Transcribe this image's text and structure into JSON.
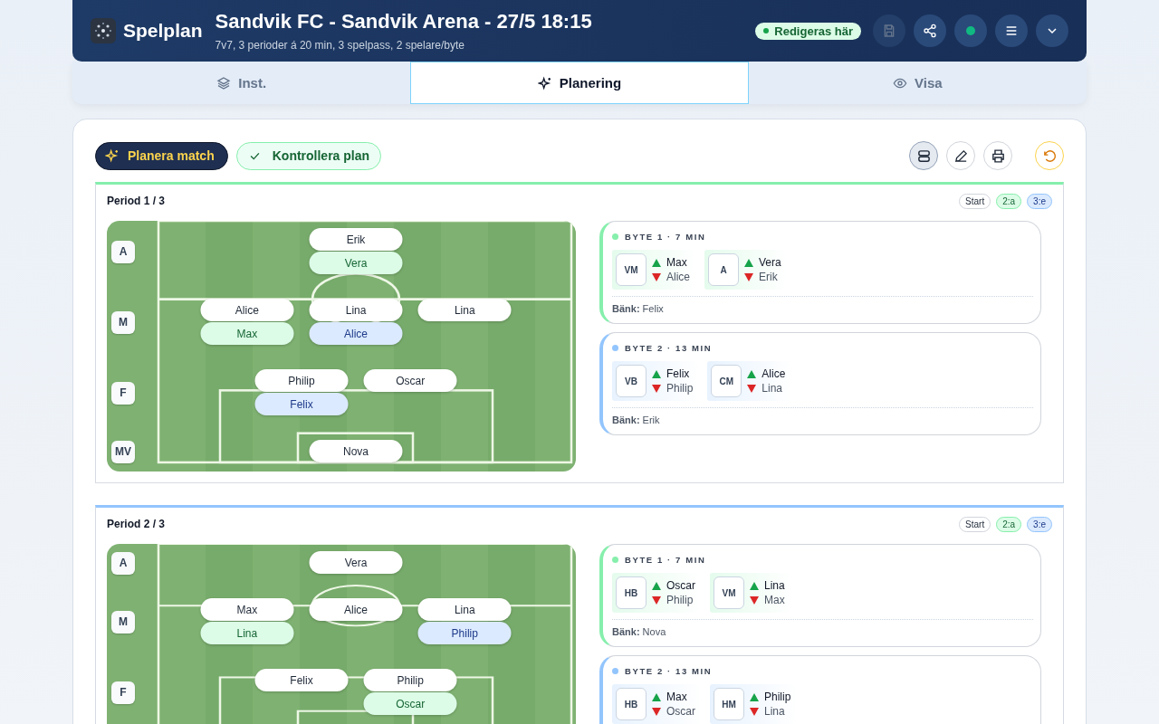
{
  "header": {
    "app_name": "Spelplan",
    "title": "Sandvik FC - Sandvik Arena - 27/5 18:15",
    "subtitle": "7v7, 3 perioder á 20 min, 3 spelpass, 2 spelare/byte",
    "badge": "Redigeras här",
    "buttons": [
      {
        "kind": "save",
        "disabled": true
      },
      {
        "kind": "share",
        "disabled": false
      },
      {
        "kind": "status",
        "disabled": false
      },
      {
        "kind": "menu",
        "disabled": false
      },
      {
        "kind": "chevron",
        "disabled": false
      }
    ]
  },
  "tabs": [
    {
      "label": "Inst.",
      "kind": "layers",
      "selected": false
    },
    {
      "label": "Planering",
      "kind": "sparkle",
      "selected": true
    },
    {
      "label": "Visa",
      "kind": "eye",
      "selected": false
    }
  ],
  "toolbar": {
    "primary": "Planera match",
    "secondary": "Kontrollera plan",
    "tools": [
      {
        "kind": "rows",
        "selected": true
      },
      {
        "kind": "pencil",
        "selected": false
      },
      {
        "kind": "printer",
        "selected": false
      },
      {
        "kind": "undo",
        "selected": false
      }
    ]
  },
  "periods": [
    {
      "title": "Period 1 / 3",
      "color": "#86efac",
      "legend": [
        {
          "label": "Start",
          "kind": "start"
        },
        {
          "label": "2:a",
          "kind": "second"
        },
        {
          "label": "3:e",
          "kind": "third"
        }
      ],
      "rows": [
        {
          "label": "A",
          "slots": [
            {
              "kind": "center",
              "players": [
                {
                  "name": "Erik",
                  "kind": "start"
                },
                {
                  "name": "Vera",
                  "kind": "second"
                }
              ]
            }
          ]
        },
        {
          "label": "M",
          "slots": [
            {
              "kind": "left",
              "players": [
                {
                  "name": "Alice",
                  "kind": "start"
                },
                {
                  "name": "Max",
                  "kind": "second"
                }
              ]
            },
            {
              "kind": "center",
              "players": [
                {
                  "name": "Lina",
                  "kind": "start"
                },
                {
                  "name": "Alice",
                  "kind": "third"
                }
              ]
            },
            {
              "kind": "right",
              "players": [
                {
                  "name": "Lina",
                  "kind": "start"
                }
              ]
            }
          ]
        },
        {
          "label": "F",
          "slots": [
            {
              "kind": "left-center",
              "players": [
                {
                  "name": "Philip",
                  "kind": "start"
                },
                {
                  "name": "Felix",
                  "kind": "third"
                }
              ]
            },
            {
              "kind": "right-center",
              "players": [
                {
                  "name": "Oscar",
                  "kind": "start"
                }
              ]
            }
          ]
        },
        {
          "label": "MV",
          "slots": [
            {
              "kind": "center",
              "players": [
                {
                  "name": "Nova",
                  "kind": "start"
                }
              ]
            }
          ]
        }
      ],
      "subs": [
        {
          "label": "BYTE 1 · 7 MIN",
          "color": "#86efac",
          "swaps": [
            {
              "position": "VM",
              "in": "Max",
              "out": "Alice"
            },
            {
              "position": "A",
              "in": "Vera",
              "out": "Erik"
            }
          ],
          "bench": "**Bänk:** Felix"
        },
        {
          "label": "BYTE 2 · 13 MIN",
          "color": "#93c5fd",
          "swaps": [
            {
              "position": "VB",
              "in": "Felix",
              "out": "Philip"
            },
            {
              "position": "CM",
              "in": "Alice",
              "out": "Lina"
            }
          ],
          "bench": "**Bänk:** Erik"
        }
      ]
    },
    {
      "title": "Period 2 / 3",
      "color": "#93c5fd",
      "legend": [
        {
          "label": "Start",
          "kind": "start"
        },
        {
          "label": "2:a",
          "kind": "second"
        },
        {
          "label": "3:e",
          "kind": "third"
        }
      ],
      "rows": [
        {
          "label": "A",
          "slots": [
            {
              "kind": "center",
              "players": [
                {
                  "name": "Vera",
                  "kind": "start"
                }
              ]
            }
          ]
        },
        {
          "label": "M",
          "slots": [
            {
              "kind": "left",
              "players": [
                {
                  "name": "Max",
                  "kind": "start"
                },
                {
                  "name": "Lina",
                  "kind": "second"
                }
              ]
            },
            {
              "kind": "center",
              "players": [
                {
                  "name": "Alice",
                  "kind": "start"
                }
              ]
            },
            {
              "kind": "right",
              "players": [
                {
                  "name": "Lina",
                  "kind": "start"
                },
                {
                  "name": "Philip",
                  "kind": "third"
                }
              ]
            }
          ]
        },
        {
          "label": "F",
          "slots": [
            {
              "kind": "left-center",
              "players": [
                {
                  "name": "Felix",
                  "kind": "start"
                }
              ]
            },
            {
              "kind": "right-center",
              "players": [
                {
                  "name": "Philip",
                  "kind": "start"
                },
                {
                  "name": "Oscar",
                  "kind": "second"
                }
              ]
            }
          ]
        }
      ],
      "subs": [
        {
          "label": "BYTE 1 · 7 MIN",
          "color": "#86efac",
          "swaps": [
            {
              "position": "HB",
              "in": "Oscar",
              "out": "Philip"
            },
            {
              "position": "VM",
              "in": "Lina",
              "out": "Max"
            }
          ],
          "bench": "**Bänk:** Nova"
        },
        {
          "label": "BYTE 2 · 13 MIN",
          "color": "#93c5fd",
          "swaps": [
            {
              "position": "HB",
              "in": "Max",
              "out": "Oscar"
            },
            {
              "position": "HM",
              "in": "Philip",
              "out": "Lina"
            }
          ]
        }
      ]
    }
  ]
}
